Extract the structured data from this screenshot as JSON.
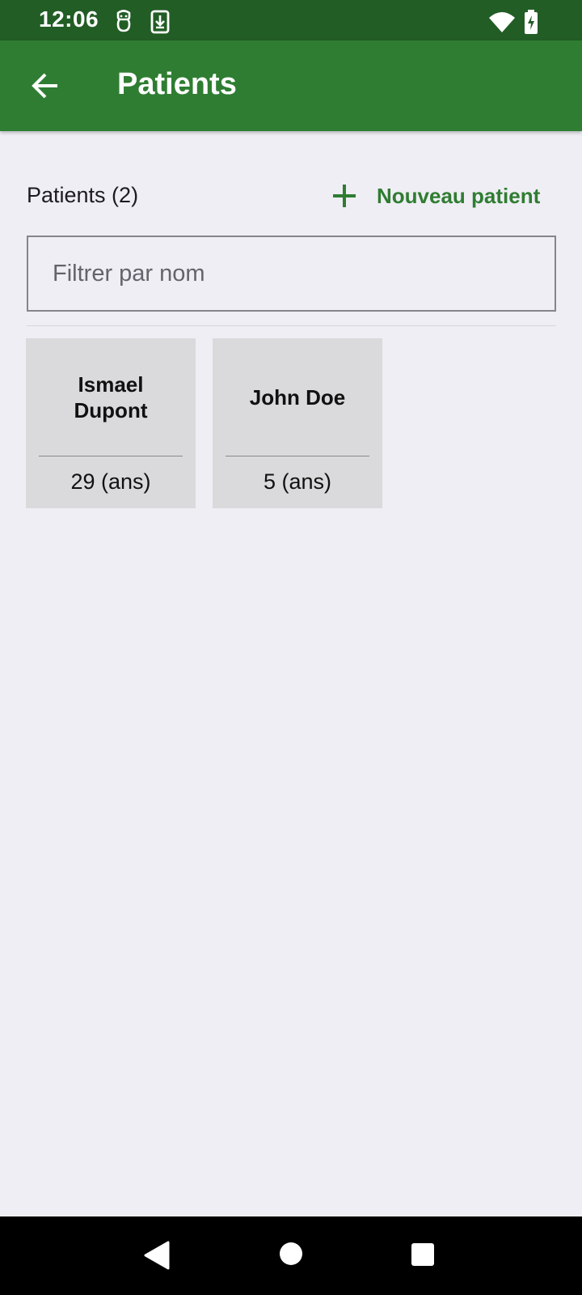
{
  "status_bar": {
    "time": "12:06",
    "icons": [
      "face-icon",
      "download-icon",
      "wifi-icon",
      "battery-charging-icon"
    ]
  },
  "app_bar": {
    "back_icon": "arrow-back-icon",
    "title": "Patients",
    "background": "#2f7d32"
  },
  "list_header": {
    "count_label": "Patients (2)",
    "new_patient_label": "Nouveau patient",
    "new_patient_icon": "plus-icon",
    "accent": "#2f7d32"
  },
  "filter": {
    "placeholder": "Filtrer par nom",
    "value": ""
  },
  "patients": [
    {
      "name": "Ismael Dupont",
      "age": "29 (ans)"
    },
    {
      "name": "John Doe",
      "age": "5 (ans)"
    }
  ],
  "nav_bar": {
    "icons": [
      "back-triangle-icon",
      "home-circle-icon",
      "recents-square-icon"
    ]
  }
}
